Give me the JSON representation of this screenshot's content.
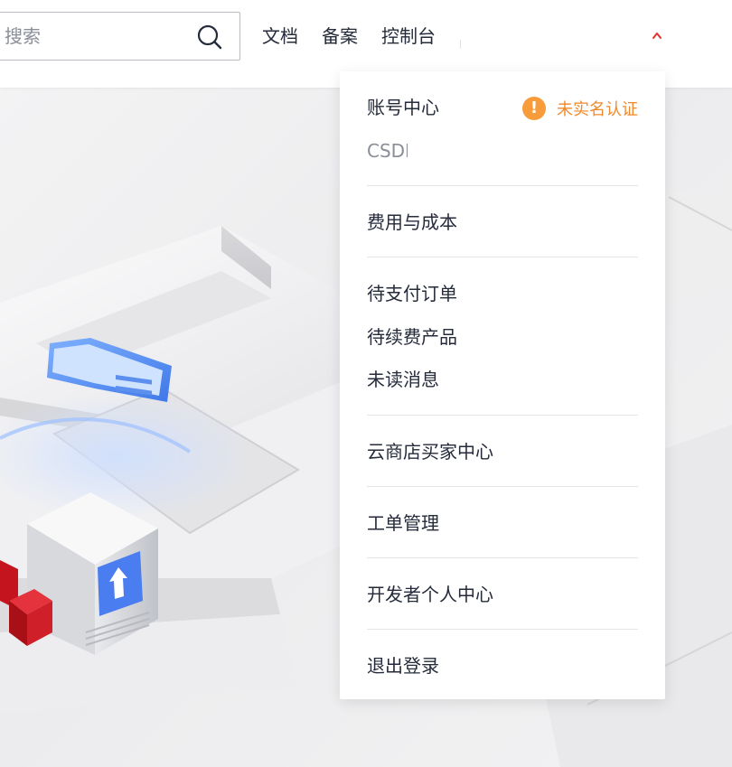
{
  "header": {
    "search_placeholder": "搜索",
    "nav": {
      "docs": "文档",
      "beian": "备案",
      "console": "控制台"
    }
  },
  "account_menu": {
    "account_center": "账号中心",
    "verify_warning": "未实名认证",
    "account_name": "CSDN",
    "billing": "费用与成本",
    "pending_orders": "待支付订单",
    "pending_renewals": "待续费产品",
    "unread_messages": "未读消息",
    "marketplace": "云商店买家中心",
    "tickets": "工单管理",
    "developer_center": "开发者个人中心",
    "logout": "退出登录"
  },
  "colors": {
    "warning": "#f79b3b",
    "warning_text": "#f0892b",
    "chevron": "#e0332e",
    "text": "#252b3a",
    "muted": "#8a8e99"
  }
}
